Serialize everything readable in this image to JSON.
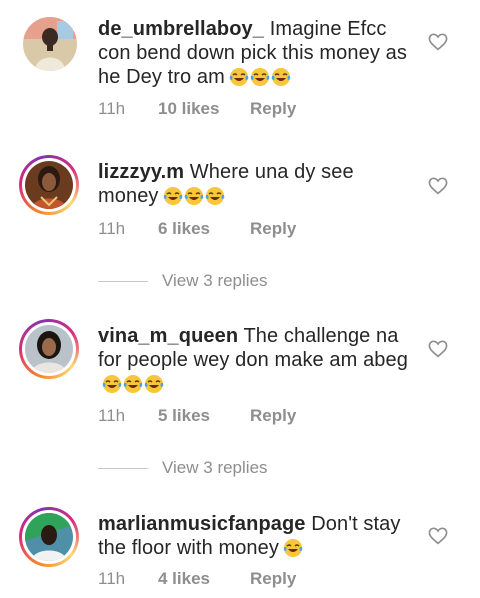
{
  "comments": [
    {
      "username": "de_umbrellaboy_",
      "text": "Imagine Efcc con bend down pick this money as he Dey tro am",
      "emoji_count": 3,
      "time": "11h",
      "likes": "10 likes",
      "reply": "Reply",
      "avatar_ring": false,
      "view_replies": null
    },
    {
      "username": "lizzzyy.m",
      "text": "Where una dy see money",
      "emoji_count": 3,
      "time": "11h",
      "likes": "6 likes",
      "reply": "Reply",
      "avatar_ring": true,
      "view_replies": "View 3 replies"
    },
    {
      "username": "vina_m_queen",
      "text": "The challenge na for people wey don make am abeg",
      "emoji_count": 3,
      "time": "11h",
      "likes": "5 likes",
      "reply": "Reply",
      "avatar_ring": true,
      "view_replies": "View 3 replies"
    },
    {
      "username": "marlianmusicfanpage",
      "text": "Don't stay the floor with money",
      "emoji_count": 1,
      "time": "11h",
      "likes": "4 likes",
      "reply": "Reply",
      "avatar_ring": true,
      "view_replies": null
    }
  ],
  "icons": {
    "like": "heart-outline-icon",
    "emoji": "face-with-tears-of-joy-emoji"
  },
  "colors": {
    "text": "#262626",
    "muted": "#8e8e8e",
    "emoji_face": "#f7c63b",
    "tears": "#4aa3e8"
  }
}
